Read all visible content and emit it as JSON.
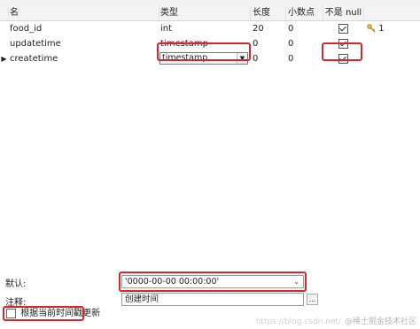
{
  "grid": {
    "headers": {
      "name": "名",
      "type": "类型",
      "length": "长度",
      "decimal": "小数点",
      "not_null": "不是 null"
    },
    "rows": [
      {
        "name": "food_id",
        "type": "int",
        "length": "20",
        "decimal": "0",
        "not_null": true,
        "key_label": "1",
        "key_icon": "key-icon"
      },
      {
        "name": "updatetime",
        "type": "timestamp",
        "length": "0",
        "decimal": "0",
        "not_null": true
      },
      {
        "name": "createtime",
        "type": "timestamp",
        "length": "0",
        "decimal": "0",
        "not_null": true,
        "selected": true,
        "row_pointer": "▶"
      }
    ]
  },
  "properties": {
    "default_label": "默认:",
    "default_value": "'0000-00-00 00:00:00'",
    "comment_label": "注释:",
    "comment_value": "创建时间",
    "ellipsis_label": "...",
    "on_update_label": "根据当前时间戳更新",
    "on_update_checked": false
  },
  "watermark": {
    "prefix": "https://blog.csdn.net/",
    "text": "@稀土掘金技术社区"
  },
  "colors": {
    "highlight": "#d9262a",
    "key": "#d4a017"
  }
}
